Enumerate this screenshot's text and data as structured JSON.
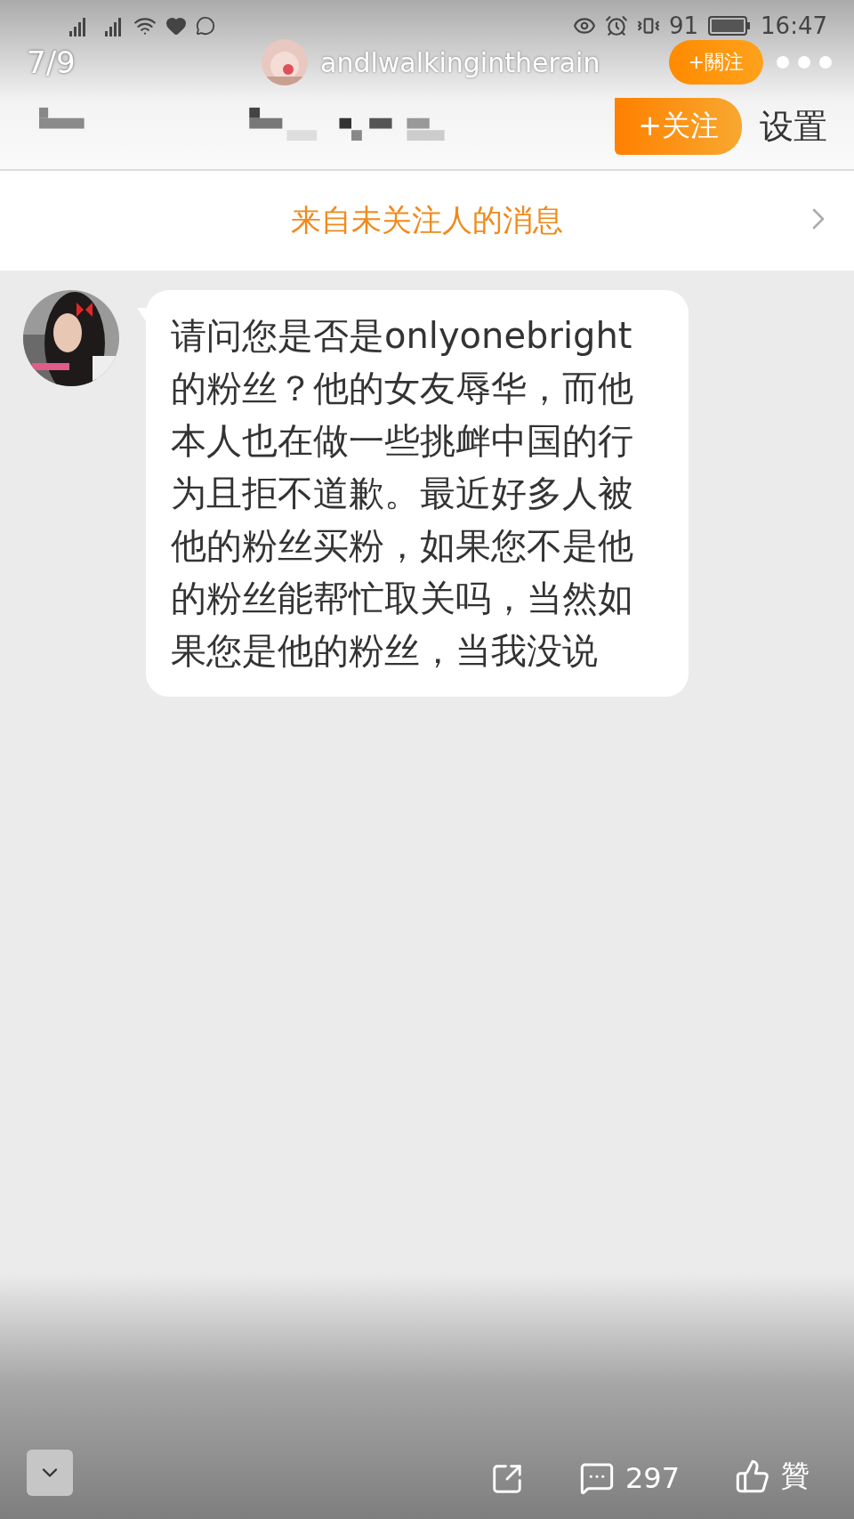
{
  "status_bar": {
    "battery": "91",
    "time": "16:47"
  },
  "viewer": {
    "counter": "7/9",
    "username": "andlwalkingintherain",
    "follow_button": "+關注"
  },
  "screenshot": {
    "header": {
      "follow_button": "+关注",
      "settings": "设置"
    },
    "banner": {
      "text": "来自未关注人的消息"
    },
    "messages": [
      {
        "text": "请问您是否是onlyonebright的粉丝？他的女友辱华，而他本人也在做一些挑衅中国的行为且拒不道歉。最近好多人被他的粉丝买粉，如果您不是他的粉丝能帮忙取关吗，当然如果您是他的粉丝，当我没说"
      }
    ]
  },
  "toolbar": {
    "comments": "297",
    "like": "贊"
  }
}
